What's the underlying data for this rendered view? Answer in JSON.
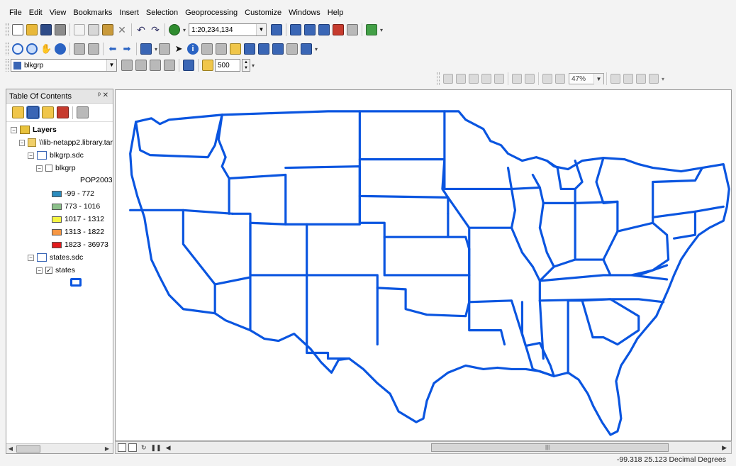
{
  "menu": [
    "File",
    "Edit",
    "View",
    "Bookmarks",
    "Insert",
    "Selection",
    "Geoprocessing",
    "Customize",
    "Windows",
    "Help"
  ],
  "standard_toolbar": {
    "scale": "1:20,234,134"
  },
  "layer_toolbar": {
    "layer": "blkgrp",
    "value": "500"
  },
  "layout_toolbar": {
    "zoom": "47%"
  },
  "toc": {
    "title": "Table Of Contents",
    "pin_close": "ᵖ ✕",
    "root": "Layers",
    "folder": "\\\\lib-netapp2.library.tar",
    "db1": "blkgrp.sdc",
    "layer1": "blkgrp",
    "field": "POP2003",
    "legend": [
      {
        "label": "-99 - 772",
        "color": "#2b8cbe"
      },
      {
        "label": "773 - 1016",
        "color": "#8cc08a"
      },
      {
        "label": "1017 - 1312",
        "color": "#f5f542"
      },
      {
        "label": "1313 - 1822",
        "color": "#f79743"
      },
      {
        "label": "1823 - 36973",
        "color": "#e31a1c"
      }
    ],
    "db2": "states.sdc",
    "layer2": "states"
  },
  "status": {
    "coords": "-99.318  25.123 Decimal Degrees"
  },
  "colors": {
    "state_outline": "#0a55e0"
  }
}
